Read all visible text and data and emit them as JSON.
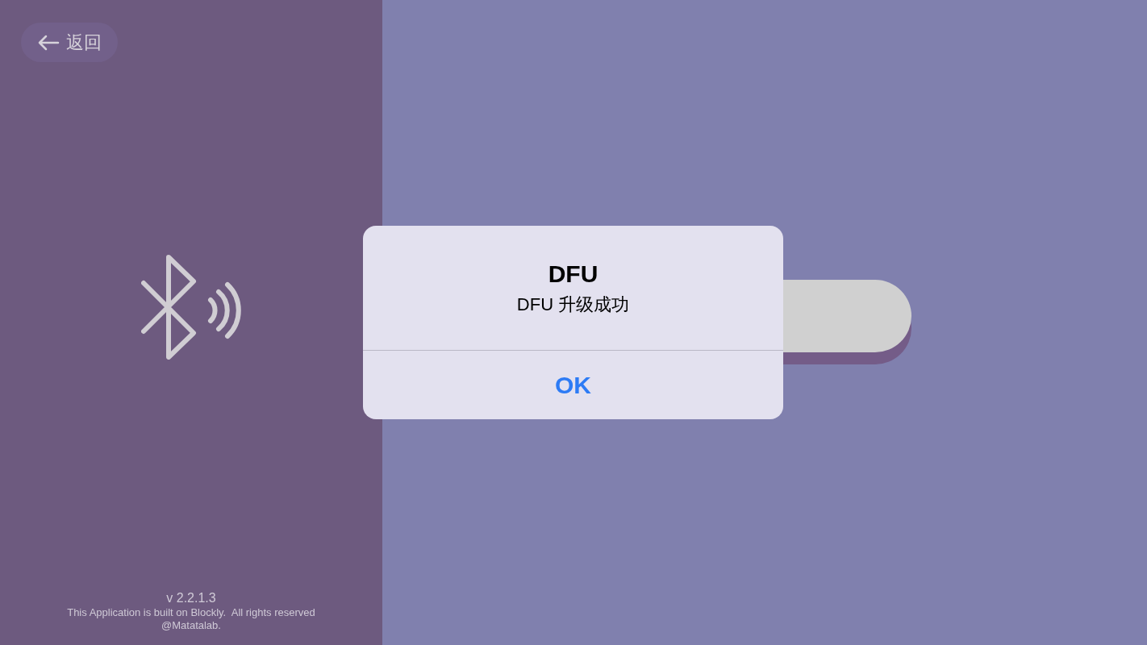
{
  "back_button": {
    "label": "返回"
  },
  "footer": {
    "version": "v 2.2.1.3",
    "notice": "This Application is built on Blockly.  All rights reserved",
    "owner": "@Matatalab."
  },
  "dialog": {
    "title": "DFU",
    "message": "DFU 升级成功",
    "buttons": [
      "OK"
    ]
  }
}
